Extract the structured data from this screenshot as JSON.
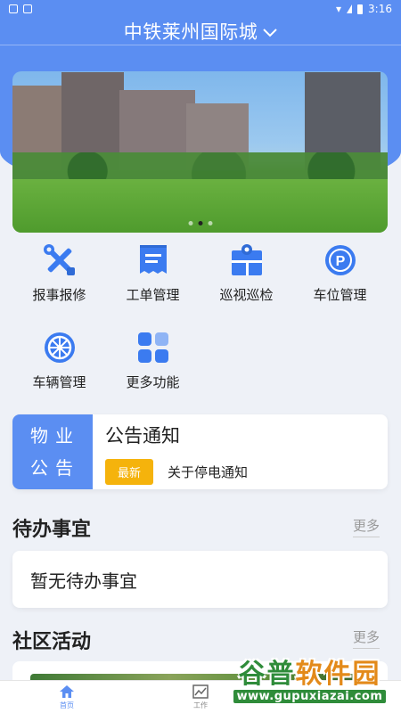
{
  "status_bar": {
    "time": "3:16"
  },
  "header": {
    "title": "中铁莱州国际城",
    "dropdown_icon": "chevron-down-icon"
  },
  "banner": {
    "image": "residential-buildings-lawn",
    "page_count": 3,
    "active_index": 1
  },
  "functions": [
    {
      "label": "报事报修",
      "icon": "tools-icon",
      "color": "#3b7bf0"
    },
    {
      "label": "工单管理",
      "icon": "workorder-icon",
      "color": "#3b7bf0"
    },
    {
      "label": "巡视巡检",
      "icon": "inspection-icon",
      "color": "#3b7bf0"
    },
    {
      "label": "车位管理",
      "icon": "parking-icon",
      "color": "#3b7bf0"
    },
    {
      "label": "车辆管理",
      "icon": "vehicle-wheel-icon",
      "color": "#3b7bf0"
    },
    {
      "label": "更多功能",
      "icon": "more-grid-icon",
      "color": "#3b7bf0"
    }
  ],
  "notice": {
    "tag_line1": "物业",
    "tag_line2": "公告",
    "title": "公告通知",
    "badge": "最新",
    "text": "关于停电通知"
  },
  "todo": {
    "title": "待办事宜",
    "more": "更多",
    "empty_text": "暂无待办事宜"
  },
  "activity": {
    "title": "社区活动",
    "more": "更多"
  },
  "bottom_nav": [
    {
      "label": "首页",
      "icon": "home-icon",
      "active": true
    },
    {
      "label": "工作",
      "icon": "chart-icon",
      "active": false
    }
  ],
  "watermark": {
    "main_prefix": "谷普",
    "main_suffix": "软件园",
    "url": "www.gupuxiazai.com"
  },
  "colors": {
    "primary": "#5b8ef2",
    "badge": "#f5b30c",
    "background": "#eef1f7"
  }
}
